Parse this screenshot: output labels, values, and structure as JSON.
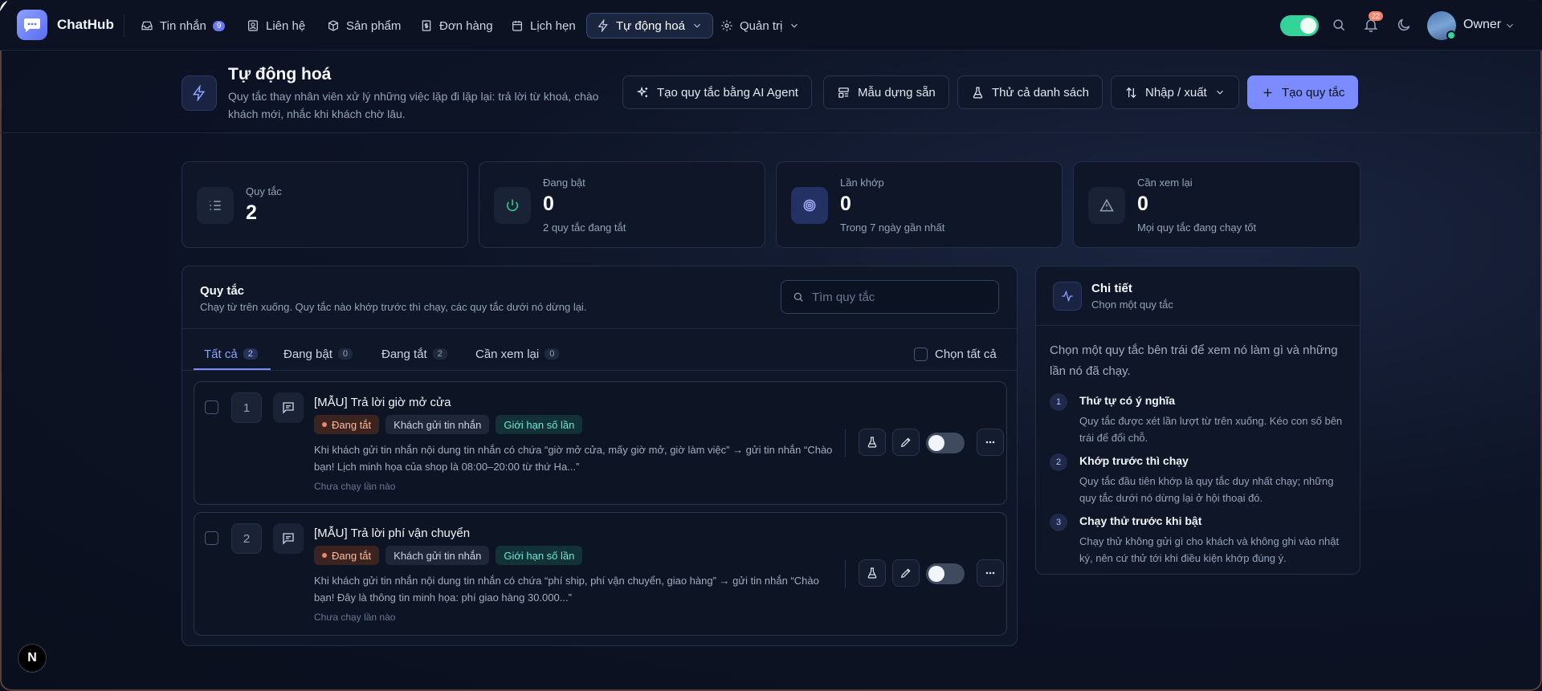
{
  "app": {
    "brand": "ChatHub"
  },
  "nav": {
    "items": [
      {
        "label": "Tin nhắn",
        "badge": "9",
        "icon": "inbox-icon"
      },
      {
        "label": "Liên hệ",
        "icon": "contact-icon"
      },
      {
        "label": "Sản phẩm",
        "icon": "box-icon"
      },
      {
        "label": "Đơn hàng",
        "icon": "receipt-icon"
      },
      {
        "label": "Lịch hẹn",
        "icon": "calendar-icon"
      },
      {
        "label": "Tự động hoá",
        "icon": "bolt-icon",
        "active": true
      },
      {
        "label": "Quản trị",
        "icon": "gear-icon"
      }
    ],
    "notif_count": "22",
    "user": "Owner"
  },
  "header": {
    "title": "Tự động hoá",
    "desc": "Quy tắc thay nhân viên xử lý những việc lặp đi lặp lại: trả lời từ khoá, chào khách mới, nhắc khi khách chờ lâu.",
    "buttons": {
      "ai": "Tạo quy tắc bằng AI Agent",
      "templates": "Mẫu dựng sẵn",
      "test_all": "Thử cả danh sách",
      "import_export": "Nhập / xuất",
      "create": "Tạo quy tắc"
    }
  },
  "stats": [
    {
      "label": "Quy tắc",
      "value": "2",
      "sub": ""
    },
    {
      "label": "Đang bật",
      "value": "0",
      "sub": "2 quy tắc đang tắt"
    },
    {
      "label": "Lần khớp",
      "value": "0",
      "sub": "Trong 7 ngày gần nhất"
    },
    {
      "label": "Cần xem lại",
      "value": "0",
      "sub": "Mọi quy tắc đang chạy tốt"
    }
  ],
  "rules_panel": {
    "title": "Quy tắc",
    "sub": "Chạy từ trên xuống. Quy tắc nào khớp trước thì chạy, các quy tắc dưới nó dừng lại.",
    "search_placeholder": "Tìm quy tắc",
    "tabs": [
      {
        "label": "Tất cả",
        "count": "2",
        "active": true
      },
      {
        "label": "Đang bật",
        "count": "0"
      },
      {
        "label": "Đang tắt",
        "count": "2"
      },
      {
        "label": "Cần xem lại",
        "count": "0"
      }
    ],
    "select_all": "Chọn tất cả",
    "rules": [
      {
        "num": "1",
        "title": "[MẪU] Trả lời giờ mở cửa",
        "status": "Đang tắt",
        "trigger": "Khách gửi tin nhắn",
        "limit": "Giới hạn số lần",
        "desc": "Khi khách gửi tin nhắn nội dung tin nhắn có chứa “giờ mở cửa, mấy giờ mở, giờ làm việc” → gửi tin nhắn “Chào bạn! Lịch minh họa của shop là 08:00–20:00 từ thứ Ha...”",
        "foot": "Chưa chạy lần nào",
        "enabled": false
      },
      {
        "num": "2",
        "title": "[MẪU] Trả lời phí vận chuyển",
        "status": "Đang tắt",
        "trigger": "Khách gửi tin nhắn",
        "limit": "Giới hạn số lần",
        "desc": "Khi khách gửi tin nhắn nội dung tin nhắn có chứa “phí ship, phí vận chuyển, giao hàng” → gửi tin nhắn “Chào bạn! Đây là thông tin minh họa: phí giao hàng 30.000...”",
        "foot": "Chưa chạy lần nào",
        "enabled": false
      }
    ]
  },
  "details": {
    "title": "Chi tiết",
    "sub": "Chọn một quy tắc",
    "intro": "Chọn một quy tắc bên trái để xem nó làm gì và những lần nó đã chạy.",
    "steps": [
      {
        "n": "1",
        "title": "Thứ tự có ý nghĩa",
        "desc": "Quy tắc được xét lần lượt từ trên xuống. Kéo con số bên trái để đổi chỗ."
      },
      {
        "n": "2",
        "title": "Khớp trước thì chạy",
        "desc": "Quy tắc đầu tiên khớp là quy tắc duy nhất chạy; những quy tắc dưới nó dừng lại ở hội thoại đó."
      },
      {
        "n": "3",
        "title": "Chạy thử trước khi bật",
        "desc": "Chạy thử không gửi gì cho khách và không ghi vào nhật ký, nên cứ thử tới khi điều kiện khớp đúng ý."
      }
    ]
  },
  "corner_badge": "N",
  "colors": {
    "accent": "#7c8cff",
    "success": "#34d399",
    "warning": "#f0836a",
    "bg": "#0b1120"
  }
}
